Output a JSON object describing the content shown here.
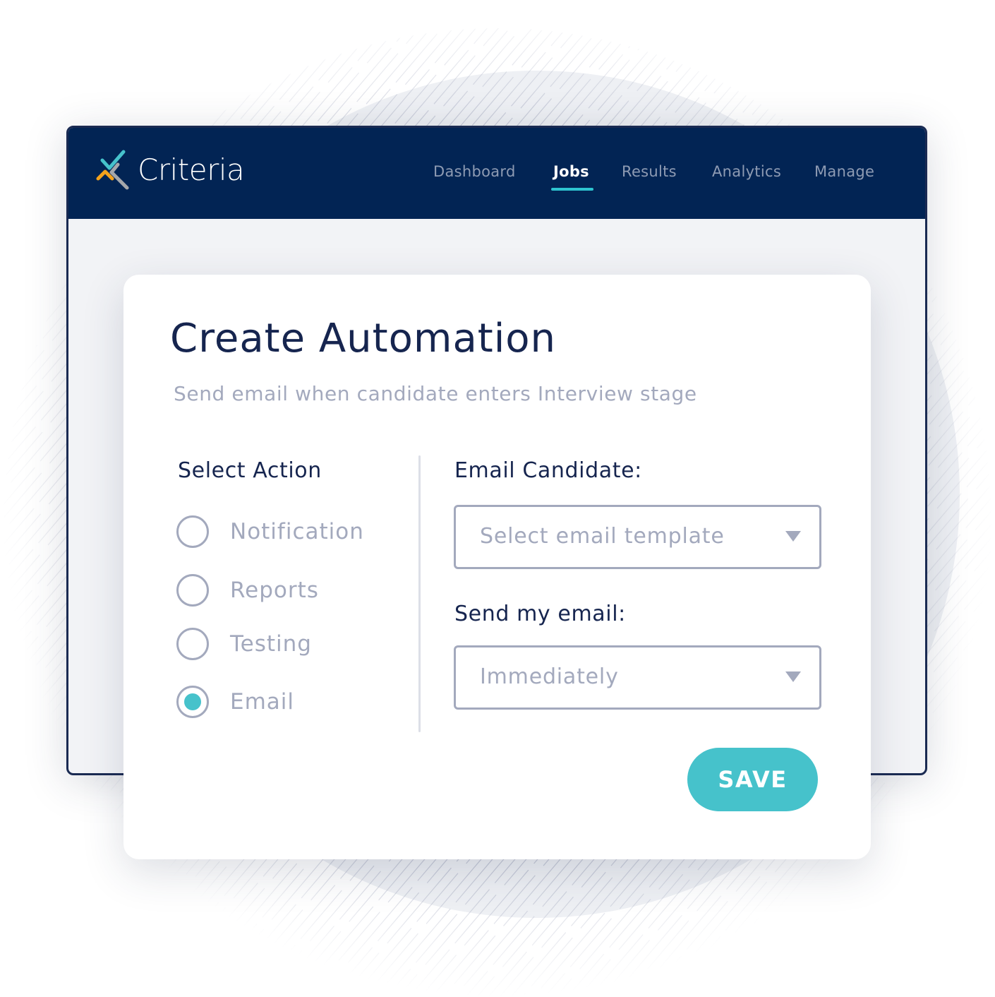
{
  "app": {
    "brand": "Criteria",
    "colors": {
      "navbar": "#022454",
      "accent": "#46c2cb",
      "heading": "#16254f",
      "muted": "#a3a9bd",
      "logo_teal": "#46c2cb",
      "logo_orange": "#f4a21c",
      "logo_gray": "#a5a7ab"
    }
  },
  "nav": {
    "items": [
      {
        "label": "Dashboard",
        "active": false
      },
      {
        "label": "Jobs",
        "active": true
      },
      {
        "label": "Results",
        "active": false
      },
      {
        "label": "Analytics",
        "active": false
      },
      {
        "label": "Manage",
        "active": false
      }
    ]
  },
  "dialog": {
    "title": "Create Automation",
    "subtitle": "Send email when candidate enters Interview stage",
    "action_section": {
      "label": "Select Action",
      "options": [
        {
          "label": "Notification",
          "selected": false
        },
        {
          "label": "Reports",
          "selected": false
        },
        {
          "label": "Testing",
          "selected": false
        },
        {
          "label": "Email",
          "selected": true
        }
      ]
    },
    "email_template": {
      "label": "Email Candidate:",
      "placeholder": "Select email template",
      "icon": "caret-down-icon"
    },
    "send_timing": {
      "label": "Send my email:",
      "value": "Immediately",
      "icon": "caret-down-icon"
    },
    "save_label": "SAVE"
  }
}
